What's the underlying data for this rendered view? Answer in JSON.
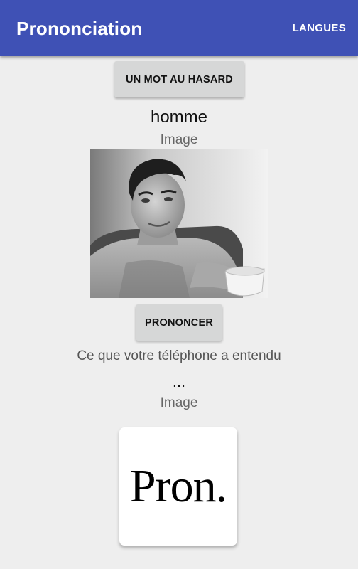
{
  "appbar": {
    "title": "Prononciation",
    "action_label": "LANGUES",
    "color": "#3f51b5"
  },
  "main": {
    "random_button_label": "UN MOT AU HASARD",
    "word": "homme",
    "image_caption": "Image",
    "pronounce_button_label": "PRONONCER",
    "heard_label": "Ce que votre téléphone a entendu",
    "heard_value": "...",
    "result_image_caption": "Image",
    "logo_text": "Pron."
  },
  "colors": {
    "background": "#eeeeee",
    "button": "#d6d7d7"
  }
}
